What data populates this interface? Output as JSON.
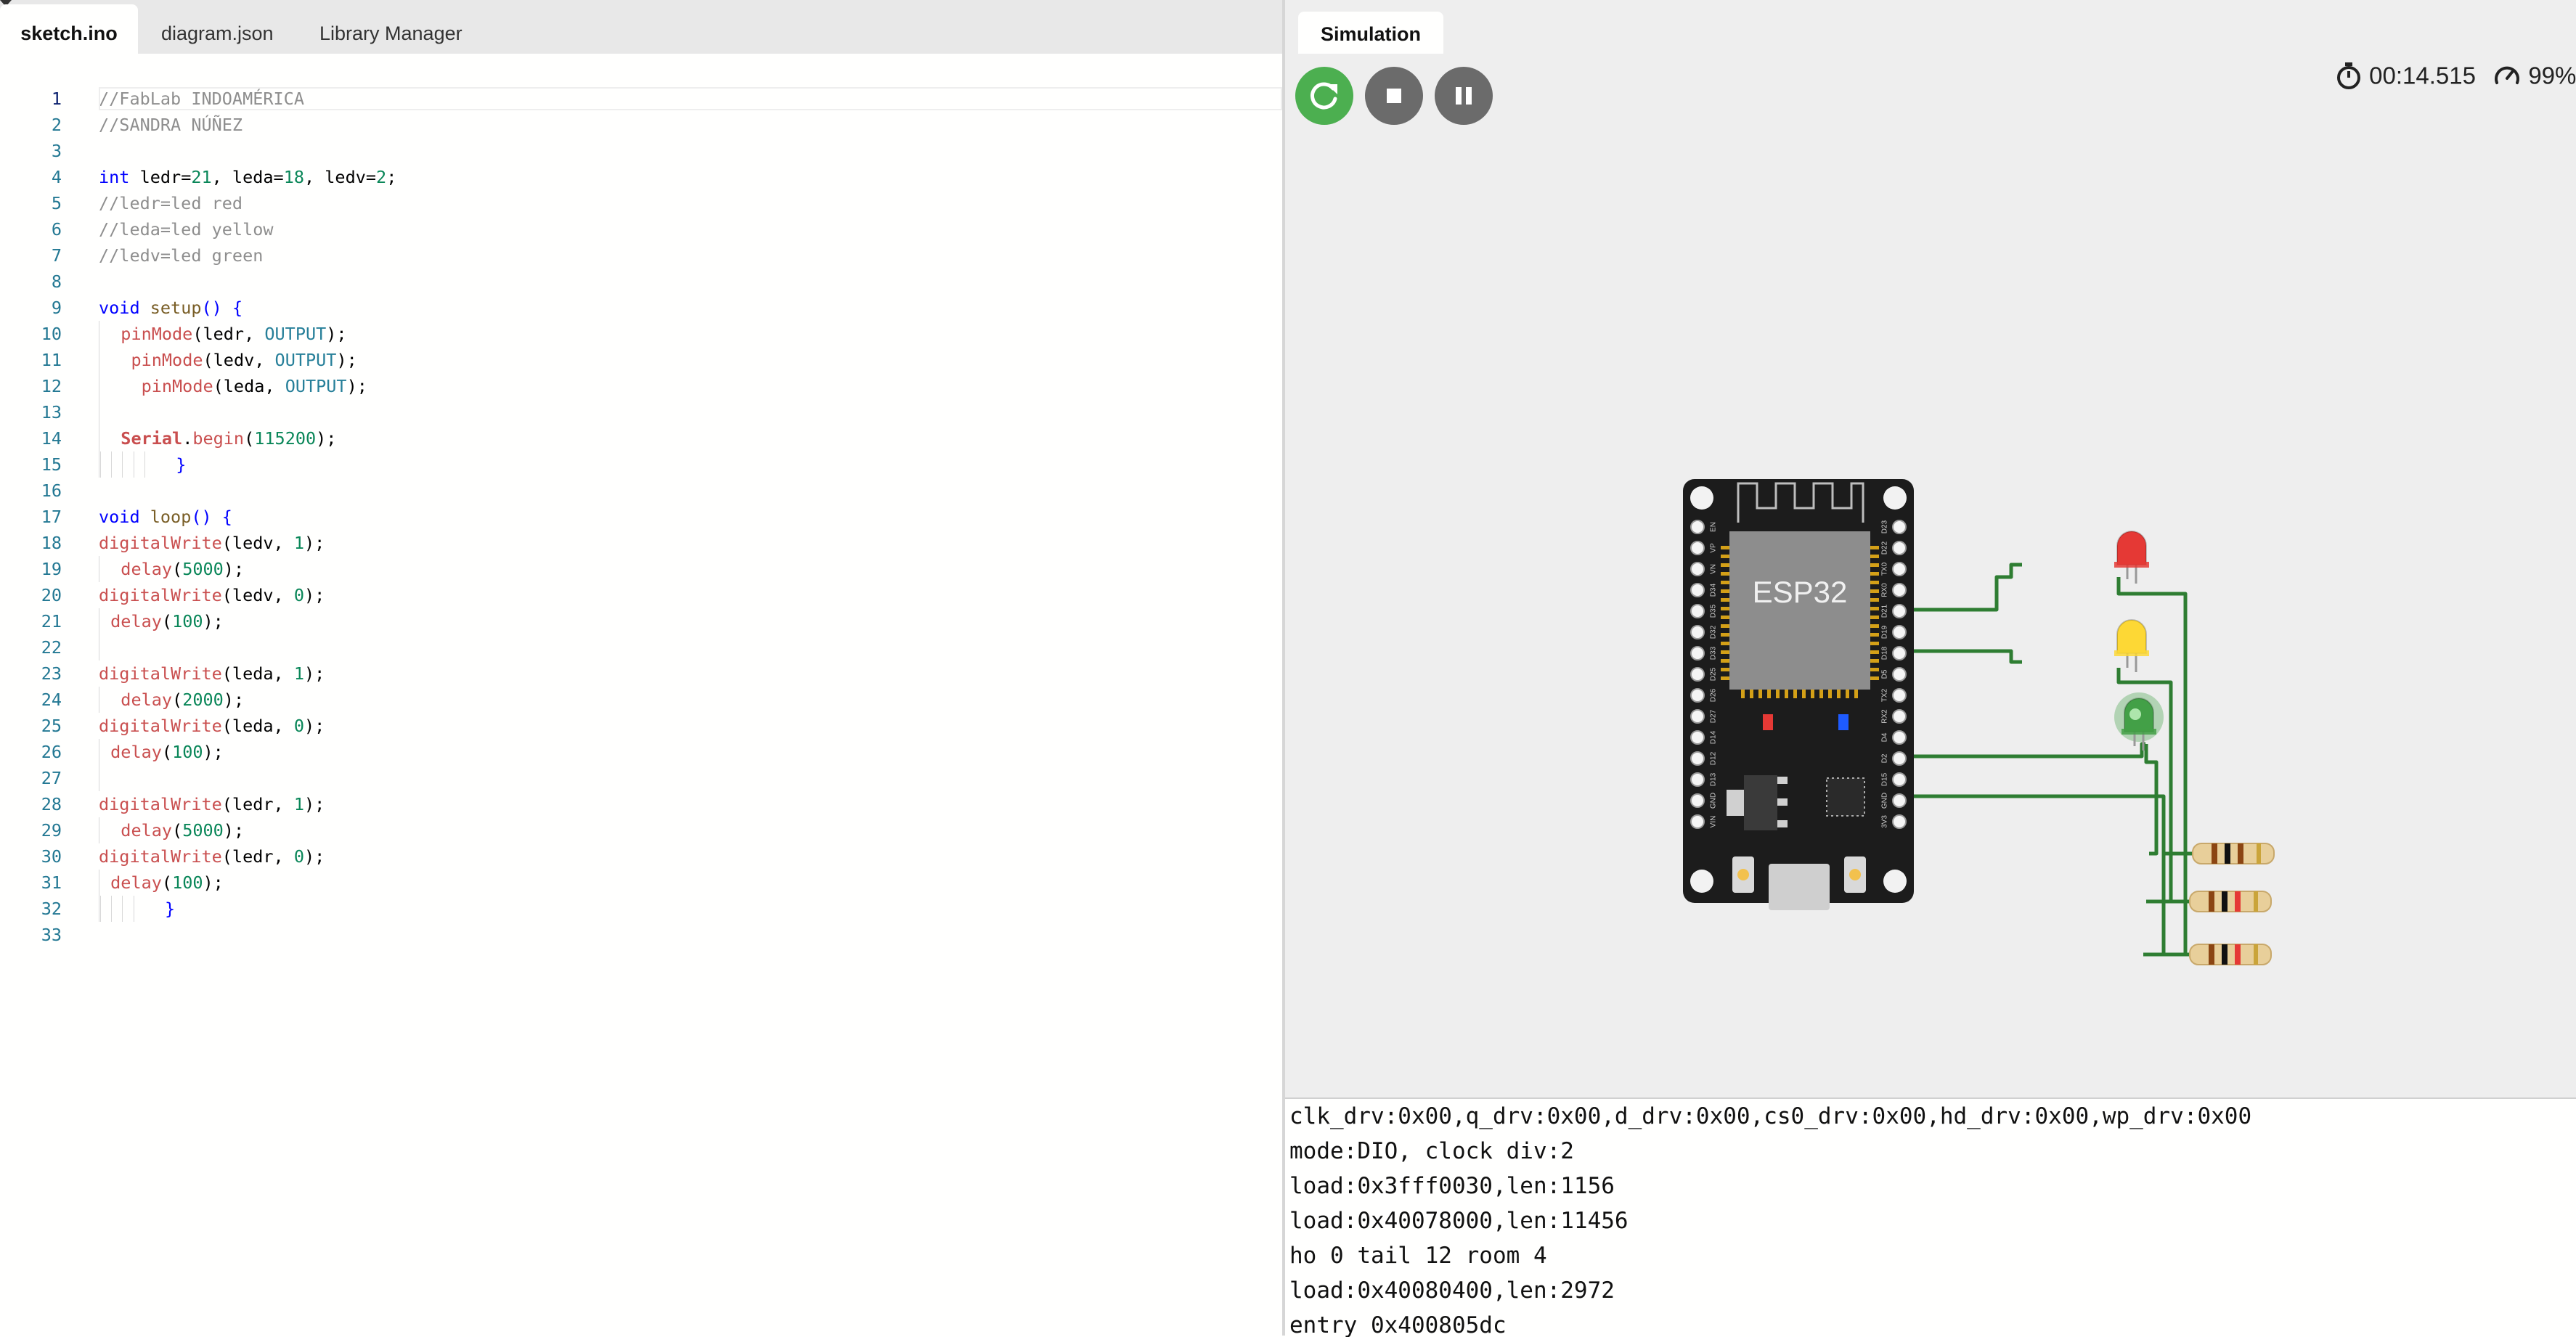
{
  "editor": {
    "tabs": [
      {
        "label": "sketch.ino"
      },
      {
        "label": "diagram.json"
      },
      {
        "label": "Library Manager"
      }
    ],
    "current_line": 1,
    "lines": [
      [
        {
          "t": "//FabLab INDOAMÉRICA",
          "c": "cm"
        }
      ],
      [
        {
          "t": "//SANDRA NÚÑEZ",
          "c": "cm"
        }
      ],
      [],
      [
        {
          "t": "int",
          "c": "kw"
        },
        {
          "t": " ledr="
        },
        {
          "t": "21",
          "c": "num"
        },
        {
          "t": ", leda="
        },
        {
          "t": "18",
          "c": "num"
        },
        {
          "t": ", ledv="
        },
        {
          "t": "2",
          "c": "num"
        },
        {
          "t": ";"
        }
      ],
      [
        {
          "t": "//ledr=led red",
          "c": "cm"
        }
      ],
      [
        {
          "t": "//leda=led yellow",
          "c": "cm"
        }
      ],
      [
        {
          "t": "//ledv=led green",
          "c": "cm"
        }
      ],
      [],
      [
        {
          "t": "void",
          "c": "kw"
        },
        {
          "t": " "
        },
        {
          "t": "setup",
          "c": "fn"
        },
        {
          "t": "() {",
          "c": "kw"
        }
      ],
      [
        {
          "g": 1
        },
        {
          "t": "  "
        },
        {
          "t": "pinMode",
          "c": "red"
        },
        {
          "t": "(ledr, "
        },
        {
          "t": "OUTPUT",
          "c": "teal"
        },
        {
          "t": ");"
        }
      ],
      [
        {
          "g": 1
        },
        {
          "t": "   "
        },
        {
          "t": "pinMode",
          "c": "red"
        },
        {
          "t": "(ledv, "
        },
        {
          "t": "OUTPUT",
          "c": "teal"
        },
        {
          "t": ");"
        }
      ],
      [
        {
          "g": 1
        },
        {
          "t": "    "
        },
        {
          "t": "pinMode",
          "c": "red"
        },
        {
          "t": "(leda, "
        },
        {
          "t": "OUTPUT",
          "c": "teal"
        },
        {
          "t": ");"
        }
      ],
      [
        {
          "g": 1
        }
      ],
      [
        {
          "g": 1
        },
        {
          "t": "  "
        },
        {
          "t": "Serial",
          "c": "ser"
        },
        {
          "t": "."
        },
        {
          "t": "begin",
          "c": "red"
        },
        {
          "t": "("
        },
        {
          "t": "115200",
          "c": "num"
        },
        {
          "t": ");"
        }
      ],
      [
        {
          "g": 6
        },
        {
          "t": "  "
        },
        {
          "t": "}",
          "c": "kw"
        }
      ],
      [],
      [
        {
          "t": "void",
          "c": "kw"
        },
        {
          "t": " "
        },
        {
          "t": "loop",
          "c": "fn"
        },
        {
          "t": "() {",
          "c": "kw"
        }
      ],
      [
        {
          "t": "digitalWrite",
          "c": "red"
        },
        {
          "t": "(ledv, "
        },
        {
          "t": "1",
          "c": "num"
        },
        {
          "t": ");"
        }
      ],
      [
        {
          "g": 1
        },
        {
          "t": "  "
        },
        {
          "t": "delay",
          "c": "red"
        },
        {
          "t": "("
        },
        {
          "t": "5000",
          "c": "num"
        },
        {
          "t": ");"
        }
      ],
      [
        {
          "t": "digitalWrite",
          "c": "red"
        },
        {
          "t": "(ledv, "
        },
        {
          "t": "0",
          "c": "num"
        },
        {
          "t": ");"
        }
      ],
      [
        {
          "g": 1
        },
        {
          "t": " "
        },
        {
          "t": "delay",
          "c": "red"
        },
        {
          "t": "("
        },
        {
          "t": "100",
          "c": "num"
        },
        {
          "t": ");"
        }
      ],
      [
        {
          "g": 1
        }
      ],
      [
        {
          "t": "digitalWrite",
          "c": "red"
        },
        {
          "t": "(leda, "
        },
        {
          "t": "1",
          "c": "num"
        },
        {
          "t": ");"
        }
      ],
      [
        {
          "g": 1
        },
        {
          "t": "  "
        },
        {
          "t": "delay",
          "c": "red"
        },
        {
          "t": "("
        },
        {
          "t": "2000",
          "c": "num"
        },
        {
          "t": ");"
        }
      ],
      [
        {
          "t": "digitalWrite",
          "c": "red"
        },
        {
          "t": "(leda, "
        },
        {
          "t": "0",
          "c": "num"
        },
        {
          "t": ");"
        }
      ],
      [
        {
          "g": 1
        },
        {
          "t": " "
        },
        {
          "t": "delay",
          "c": "red"
        },
        {
          "t": "("
        },
        {
          "t": "100",
          "c": "num"
        },
        {
          "t": ");"
        }
      ],
      [
        {
          "g": 1
        }
      ],
      [
        {
          "t": "digitalWrite",
          "c": "red"
        },
        {
          "t": "(ledr, "
        },
        {
          "t": "1",
          "c": "num"
        },
        {
          "t": ");"
        }
      ],
      [
        {
          "g": 1
        },
        {
          "t": "  "
        },
        {
          "t": "delay",
          "c": "red"
        },
        {
          "t": "("
        },
        {
          "t": "5000",
          "c": "num"
        },
        {
          "t": ");"
        }
      ],
      [
        {
          "t": "digitalWrite",
          "c": "red"
        },
        {
          "t": "(ledr, "
        },
        {
          "t": "0",
          "c": "num"
        },
        {
          "t": ");"
        }
      ],
      [
        {
          "g": 1
        },
        {
          "t": " "
        },
        {
          "t": "delay",
          "c": "red"
        },
        {
          "t": "("
        },
        {
          "t": "100",
          "c": "num"
        },
        {
          "t": ");"
        }
      ],
      [
        {
          "g": 5
        },
        {
          "t": "  "
        },
        {
          "t": "}",
          "c": "kw"
        }
      ],
      []
    ]
  },
  "simulation": {
    "tab_label": "Simulation",
    "buttons": {
      "restart_icon": "restart-icon",
      "stop_icon": "stop-icon",
      "pause_icon": "pause-icon"
    },
    "elapsed": "00:14.515",
    "speed": "99%",
    "board_label": "ESP32",
    "left_pins": [
      "EN",
      "VP",
      "VN",
      "D34",
      "D35",
      "D32",
      "D33",
      "D25",
      "D26",
      "D27",
      "D14",
      "D12",
      "D13",
      "GND",
      "VIN"
    ],
    "right_pins": [
      "D23",
      "D22",
      "TX0",
      "RX0",
      "D21",
      "D19",
      "D18",
      "D5",
      "TX2",
      "RX2",
      "D4",
      "D2",
      "D15",
      "GND",
      "3V3"
    ],
    "leds": [
      {
        "name": "red",
        "color": "#e53935",
        "lit": false
      },
      {
        "name": "yellow",
        "color": "#fdd835",
        "lit": false
      },
      {
        "name": "green",
        "color": "#43a047",
        "lit": true
      }
    ],
    "wire_color": "#2e7d32"
  },
  "serial_monitor": {
    "lines": [
      "clk_drv:0x00,q_drv:0x00,d_drv:0x00,cs0_drv:0x00,hd_drv:0x00,wp_drv:0x00",
      "mode:DIO, clock div:2",
      "load:0x3fff0030,len:1156",
      "load:0x40078000,len:11456",
      "ho 0 tail 12 room 4",
      "load:0x40080400,len:2972",
      "entry 0x400805dc"
    ]
  }
}
